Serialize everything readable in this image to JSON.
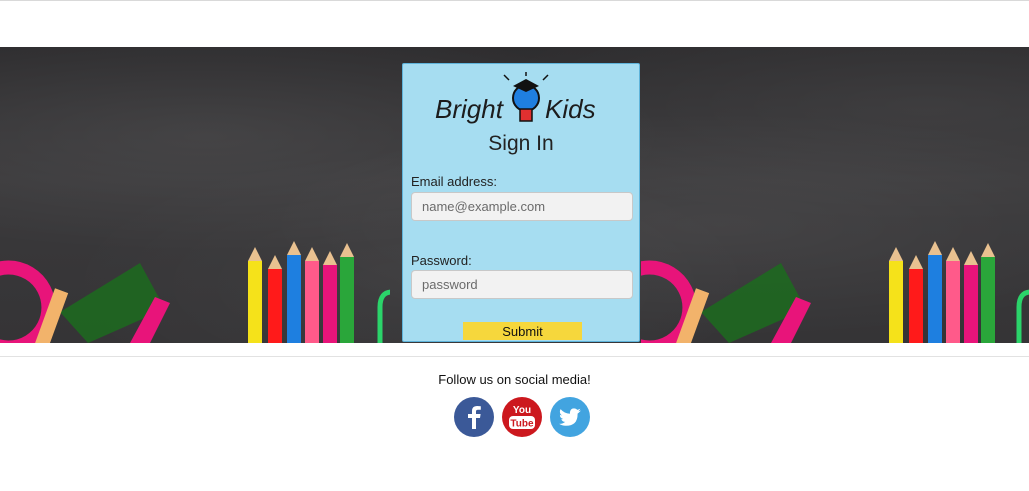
{
  "brand": {
    "name_left": "Bright",
    "name_right": "Kids"
  },
  "signin": {
    "title": "Sign In",
    "email_label": "Email address:",
    "email_placeholder": "name@example.com",
    "password_label": "Password:",
    "password_placeholder": "password",
    "submit_label": "Submit"
  },
  "footer": {
    "follow_text": "Follow us on social media!",
    "social": [
      {
        "icon": "facebook-icon",
        "color": "#3b5998"
      },
      {
        "icon": "youtube-icon",
        "color": "#cc181e",
        "text_top": "You",
        "text_bottom": "Tube"
      },
      {
        "icon": "twitter-icon",
        "color": "#42a4e0"
      }
    ]
  },
  "colors": {
    "card_bg": "#a6ddf1",
    "submit_bg": "#f6d73c",
    "chalkboard": "#353436"
  }
}
